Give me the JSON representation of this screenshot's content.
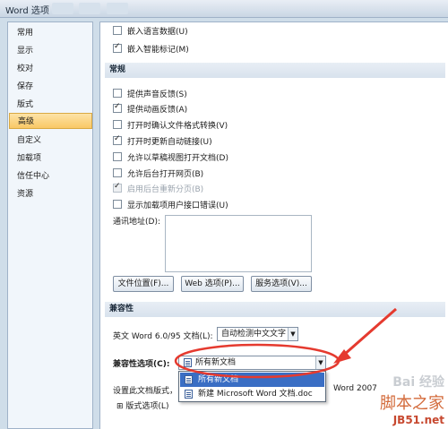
{
  "window": {
    "title": "Word 选项"
  },
  "sidebar": {
    "items": [
      {
        "label": "常用"
      },
      {
        "label": "显示"
      },
      {
        "label": "校对"
      },
      {
        "label": "保存"
      },
      {
        "label": "版式"
      },
      {
        "label": "高级",
        "selected": true
      },
      {
        "label": "自定义"
      },
      {
        "label": "加载项"
      },
      {
        "label": "信任中心"
      },
      {
        "label": "资源"
      }
    ]
  },
  "top_options": [
    {
      "label": "嵌入语言数据(U)",
      "checked": false
    },
    {
      "label": "嵌入智能标记(M)",
      "checked": true
    }
  ],
  "general": {
    "heading": "常规",
    "options": [
      {
        "label": "提供声音反馈(S)",
        "checked": false,
        "disabled": false
      },
      {
        "label": "提供动画反馈(A)",
        "checked": true,
        "disabled": false
      },
      {
        "label": "打开时确认文件格式转换(V)",
        "checked": false,
        "disabled": false
      },
      {
        "label": "打开时更新自动链接(U)",
        "checked": true,
        "disabled": false
      },
      {
        "label": "允许以草稿视图打开文档(D)",
        "checked": false,
        "disabled": false
      },
      {
        "label": "允许后台打开网页(B)",
        "checked": false,
        "disabled": false
      },
      {
        "label": "启用后台重新分页(B)",
        "checked": true,
        "disabled": true
      },
      {
        "label": "显示加载项用户接口错误(U)",
        "checked": false,
        "disabled": false
      }
    ],
    "mailing_address_label": "通讯地址(D):",
    "mailing_address_value": "",
    "buttons": {
      "file_locations": "文件位置(F)...",
      "web_options": "Web 选项(P)...",
      "service_options": "服务选项(V)..."
    }
  },
  "compatibility": {
    "heading": "兼容性",
    "english_word_label": "英文 Word 6.0/95 文档(L):",
    "english_word_value": "自动检测中文文字",
    "options_label": "兼容性选项(C):",
    "options_value": "所有新文档",
    "dropdown_options": [
      "所有新文档",
      "新建 Microsoft Word 文档.doc"
    ],
    "highlighted_option": 0,
    "layout_as_label": "设置此文档版式，",
    "layout_as_value": "Word 2007",
    "layout_options_label": "版式选项(L)"
  },
  "watermark": {
    "brand": "Bai 经验",
    "site_name": "脚本之家",
    "url": "JB51.net"
  },
  "annotation": {
    "color": "#e53a2f"
  }
}
